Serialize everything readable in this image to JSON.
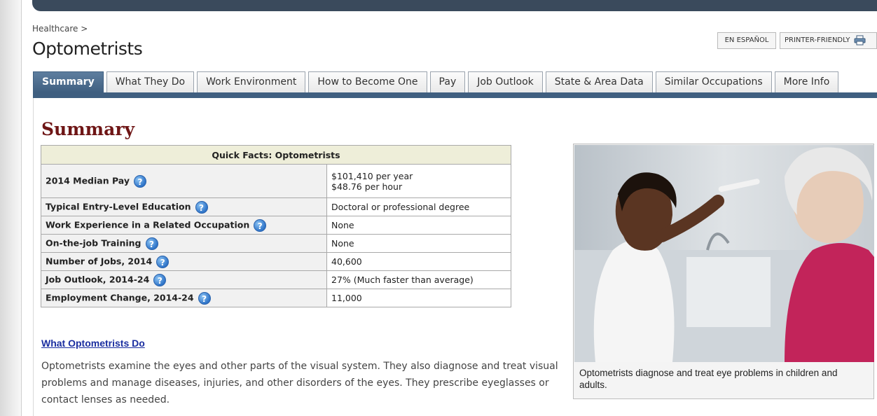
{
  "breadcrumb": {
    "text": "Healthcare >"
  },
  "page": {
    "title": "Optometrists"
  },
  "utility": {
    "spanish": "EN ESPAÑOL",
    "printer": "PRINTER-FRIENDLY"
  },
  "tabs": [
    {
      "label": "Summary",
      "active": true
    },
    {
      "label": "What They Do"
    },
    {
      "label": "Work Environment"
    },
    {
      "label": "How to Become One"
    },
    {
      "label": "Pay"
    },
    {
      "label": "Job Outlook"
    },
    {
      "label": "State & Area Data"
    },
    {
      "label": "Similar Occupations"
    },
    {
      "label": "More Info"
    }
  ],
  "summary": {
    "heading": "Summary",
    "table_title": "Quick Facts: Optometrists",
    "rows": [
      {
        "label": "2014 Median Pay",
        "value": "$101,410 per year",
        "value2": "$48.76 per hour"
      },
      {
        "label": "Typical Entry-Level Education",
        "value": "Doctoral or professional degree"
      },
      {
        "label": "Work Experience in a Related Occupation",
        "value": "None"
      },
      {
        "label": "On-the-job Training",
        "value": "None"
      },
      {
        "label": "Number of Jobs, 2014",
        "value": "40,600"
      },
      {
        "label": "Job Outlook, 2014-24",
        "value": "27% (Much faster than average)"
      },
      {
        "label": "Employment Change, 2014-24",
        "value": "11,000"
      }
    ],
    "help_glyph": "?"
  },
  "what_they_do": {
    "link": "What Optometrists Do",
    "text": "Optometrists examine the eyes and other parts of the visual system. They also diagnose and treat visual problems and manage diseases, injuries, and other disorders of the eyes. They prescribe eyeglasses or contact lenses as needed."
  },
  "photo": {
    "caption": "Optometrists diagnose and treat eye problems in children and adults."
  },
  "colors": {
    "heading": "#6e1515",
    "tab_active": "#3f5f80",
    "link": "#1a2ea0",
    "table_header": "#eeeed9"
  }
}
